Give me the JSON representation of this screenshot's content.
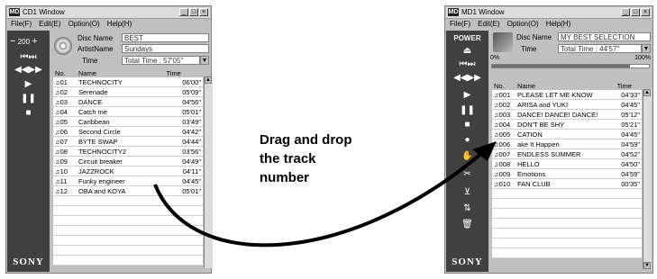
{
  "cd_window": {
    "title": "CD1 Window",
    "logo": "MD",
    "menu": [
      "File(F)",
      "Edit(E)",
      "Option(O)",
      "Help(H)"
    ],
    "level": "200",
    "disc_name_label": "Disc Name",
    "disc_name": "BEST",
    "artist_label": "ArtistName",
    "artist": "Sundays",
    "time_label": "Time",
    "total_time": "Total Time : 57'05\"",
    "col_no": "No.",
    "col_name": "Name",
    "col_time": "Time",
    "tracks": [
      {
        "no": "01",
        "name": "TECHNOCITY",
        "time": "06'00\""
      },
      {
        "no": "02",
        "name": "Serenade",
        "time": "05'09\""
      },
      {
        "no": "03",
        "name": "DANCE",
        "time": "04'56\""
      },
      {
        "no": "04",
        "name": "Catch me",
        "time": "05'01\""
      },
      {
        "no": "05",
        "name": "Caribbean",
        "time": "03'49\""
      },
      {
        "no": "06",
        "name": "Second Circle",
        "time": "04'42\""
      },
      {
        "no": "07",
        "name": "BYTE SWAP",
        "time": "04'44\""
      },
      {
        "no": "08",
        "name": "TECHNOCITY2",
        "time": "03'56\""
      },
      {
        "no": "09",
        "name": "Circuit breaker",
        "time": "04'49\""
      },
      {
        "no": "10",
        "name": "JAZZROCK",
        "time": "04'11\""
      },
      {
        "no": "11",
        "name": "Funky engineer",
        "time": "04'45\""
      },
      {
        "no": "12",
        "name": "OBA and KOYA",
        "time": "05'01\""
      }
    ],
    "brand": "SONY"
  },
  "md_window": {
    "title": "MD1 Window",
    "logo": "MD",
    "menu": [
      "File(F)",
      "Edit(E)",
      "Option(O)",
      "Help(H)"
    ],
    "power": "POWER",
    "disc_name_label": "Disc Name",
    "disc_name": "MY BEST SELECTION",
    "time_label": "Time",
    "total_time": "Total Time : 44'57\"",
    "progress_min": "0%",
    "progress_max": "100%",
    "progress_fraction": 0.88,
    "col_no": "No.",
    "col_name": "Name",
    "col_time": "Time",
    "tracks": [
      {
        "no": "001",
        "name": "PLEASE LET ME KNOW",
        "time": "04'33\""
      },
      {
        "no": "002",
        "name": "ARISA and YUKI",
        "time": "04'45\""
      },
      {
        "no": "003",
        "name": "DANCE! DANCE! DANCE!",
        "time": "05'12\""
      },
      {
        "no": "004",
        "name": "DON'T BE SHY",
        "time": "05'21\""
      },
      {
        "no": "005",
        "name": "CATION",
        "time": "04'45\""
      },
      {
        "no": "006",
        "name": "ake It Happen",
        "time": "04'59\""
      },
      {
        "no": "007",
        "name": "ENDLESS SUMMER",
        "time": "04'52\""
      },
      {
        "no": "008",
        "name": "HELLO",
        "time": "04'50\""
      },
      {
        "no": "009",
        "name": "Emotions",
        "time": "04'59\""
      },
      {
        "no": "010",
        "name": "FAN CLUB",
        "time": "00'35\""
      }
    ],
    "brand": "SONY"
  },
  "callout": {
    "line1": "Drag and drop",
    "line2": "the track",
    "line3": "number"
  }
}
